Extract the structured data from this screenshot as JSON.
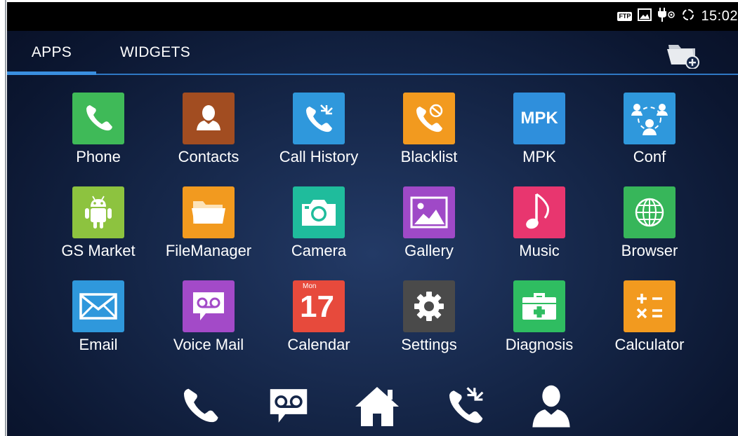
{
  "status_bar": {
    "time": "15:02",
    "ftp_badge": "FTP",
    "icons": [
      "ftp-icon",
      "picture-icon",
      "usb-plug-icon",
      "sync-icon"
    ]
  },
  "tabs": [
    {
      "label": "APPS",
      "active": true
    },
    {
      "label": "WIDGETS",
      "active": false
    }
  ],
  "apps": [
    {
      "label": "Phone",
      "icon": "phone-icon",
      "color": "#3fba58"
    },
    {
      "label": "Contacts",
      "icon": "contacts-icon",
      "color": "#a24d21"
    },
    {
      "label": "Call History",
      "icon": "call-history-icon",
      "color": "#2f98dc"
    },
    {
      "label": "Blacklist",
      "icon": "blacklist-icon",
      "color": "#f29a1f"
    },
    {
      "label": "MPK",
      "icon": "mpk-icon",
      "color": "#2f8fdc",
      "icon_text": "MPK"
    },
    {
      "label": "Conf",
      "icon": "conference-icon",
      "color": "#2f98dc"
    },
    {
      "label": "GS Market",
      "icon": "android-icon",
      "color": "#8dc33f"
    },
    {
      "label": "FileManager",
      "icon": "folder-icon",
      "color": "#f29a1f"
    },
    {
      "label": "Camera",
      "icon": "camera-icon",
      "color": "#1fbc9c"
    },
    {
      "label": "Gallery",
      "icon": "gallery-icon",
      "color": "#9f49c7"
    },
    {
      "label": "Music",
      "icon": "music-note-icon",
      "color": "#e8366f"
    },
    {
      "label": "Browser",
      "icon": "globe-icon",
      "color": "#37b65a"
    },
    {
      "label": "Email",
      "icon": "envelope-icon",
      "color": "#2f98dc"
    },
    {
      "label": "Voice Mail",
      "icon": "voicemail-icon",
      "color": "#a34ac8"
    },
    {
      "label": "Calendar",
      "icon": "calendar-icon",
      "color": "#e74a3c",
      "icon_text": "17",
      "icon_subtext": "Mon"
    },
    {
      "label": "Settings",
      "icon": "gear-icon",
      "color": "#4a4a4a"
    },
    {
      "label": "Diagnosis",
      "icon": "first-aid-kit-icon",
      "color": "#2fbd61"
    },
    {
      "label": "Calculator",
      "icon": "calculator-icon",
      "color": "#f29a1f"
    }
  ],
  "dock": [
    {
      "name": "phone",
      "icon": "phone-icon"
    },
    {
      "name": "voicemail",
      "icon": "voicemail-icon"
    },
    {
      "name": "home",
      "icon": "home-icon"
    },
    {
      "name": "call-history",
      "icon": "call-history-icon"
    },
    {
      "name": "contacts",
      "icon": "contact-person-icon"
    }
  ],
  "colors": {
    "status_bar": "#000000",
    "tab_accent": "#3a8fe0",
    "background": "#152648",
    "text": "#ffffff"
  }
}
